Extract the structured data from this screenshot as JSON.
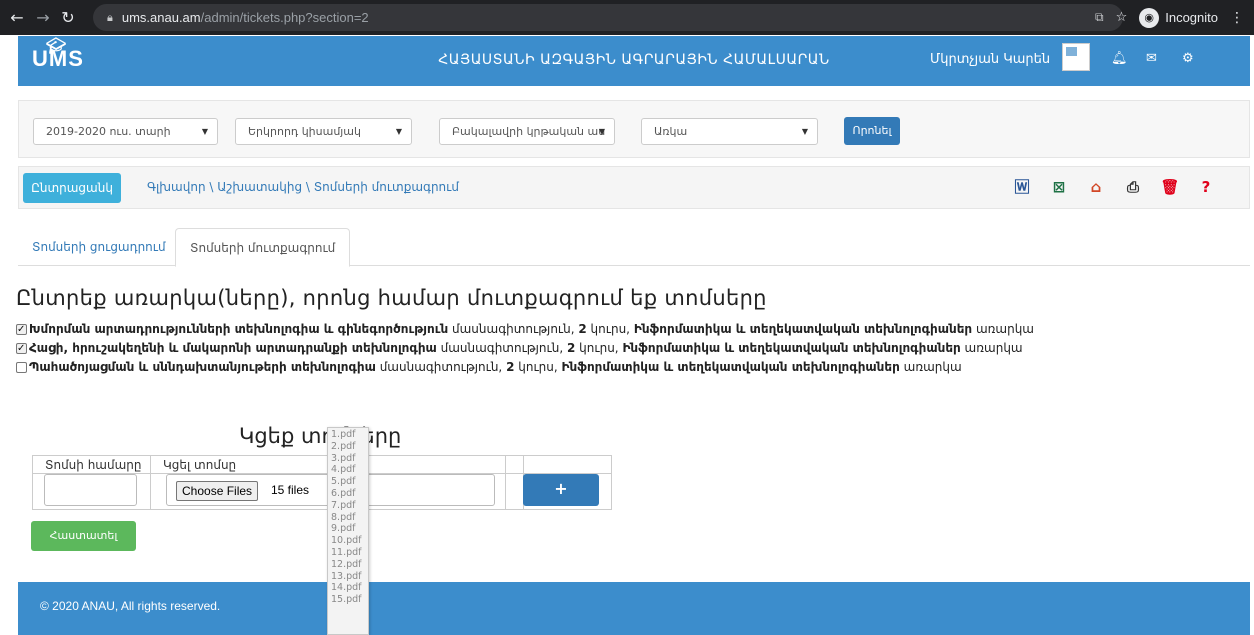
{
  "browser": {
    "url_host": "ums.anau.am",
    "url_path": "/admin/tickets.php?section=2",
    "incognito_label": "Incognito"
  },
  "header": {
    "logo": "UMS",
    "title": "ՀԱՅԱՍՏԱՆԻ ԱԶԳԱՅԻՆ ԱԳՐԱՐԱՅԻՆ ՀԱՄԱԼՍԱՐԱՆ",
    "user": "Մկրտչյան Կարեն"
  },
  "filters": {
    "year": "2019-2020 ուս. տարի",
    "semester": "Երկրորդ կիսամյակ",
    "level": "Բակալավրի կրթական աս",
    "form": "Առկա",
    "submit": "Որոնել"
  },
  "breadcrumb": {
    "back": "Ընտրացանկ",
    "path": "Գլխավոր \\ Աշխատակից \\ Տոմսերի մուտքագրում"
  },
  "tabs": [
    "Տոմսերի ցուցադրում",
    "Տոմսերի մուտքագրում"
  ],
  "section_title": "Ընտրեք առարկա(ները), որոնց համար մուտքագրում եք տոմսերը",
  "subjects": [
    {
      "checked": true,
      "name": "Խմորման արտադրությունների տեխնոլոգիա և գինեգործություն",
      "spec_word": " մասնագիտություն, ",
      "course_num": "2",
      "course_word": " կուրս, ",
      "subject": "Ինֆորմատիկա և տեղեկատվական տեխնոլոգիաներ",
      "subject_word": " առարկա"
    },
    {
      "checked": true,
      "name": "Հացի, հրուշակեղենի և մակարոնի արտադրանքի տեխնոլոգիա",
      "spec_word": " մասնագիտություն, ",
      "course_num": "2",
      "course_word": " կուրս, ",
      "subject": "Ինֆորմատիկա և տեղեկատվական տեխնոլոգիաներ",
      "subject_word": " առարկա"
    },
    {
      "checked": false,
      "name": "Պահածոյացման և սննդախտանյութերի տեխնոլոգիա",
      "spec_word": " մասնագիտություն, ",
      "course_num": "2",
      "course_word": " կուրս, ",
      "subject": "Ինֆորմատիկա և տեղեկատվական տեխնոլոգիաներ",
      "subject_word": " առարկա"
    }
  ],
  "upload": {
    "title": "Կցեք տոմսերը",
    "col_number": "Տոմսի համարը",
    "col_attach": "Կցել տոմսը",
    "choose_files": "Choose Files",
    "files_count": "15 files",
    "plus": "+",
    "confirm": "Հաստատել"
  },
  "file_list": [
    "1.pdf",
    "2.pdf",
    "3.pdf",
    "4.pdf",
    "5.pdf",
    "6.pdf",
    "7.pdf",
    "8.pdf",
    "9.pdf",
    "10.pdf",
    "11.pdf",
    "12.pdf",
    "13.pdf",
    "14.pdf",
    "15.pdf"
  ],
  "footer": "© 2020 ANAU, All rights reserved.",
  "colors": {
    "primary": "#3c8dcc",
    "button": "#337ab7",
    "success": "#5cb85c",
    "info": "#3eb0db"
  }
}
